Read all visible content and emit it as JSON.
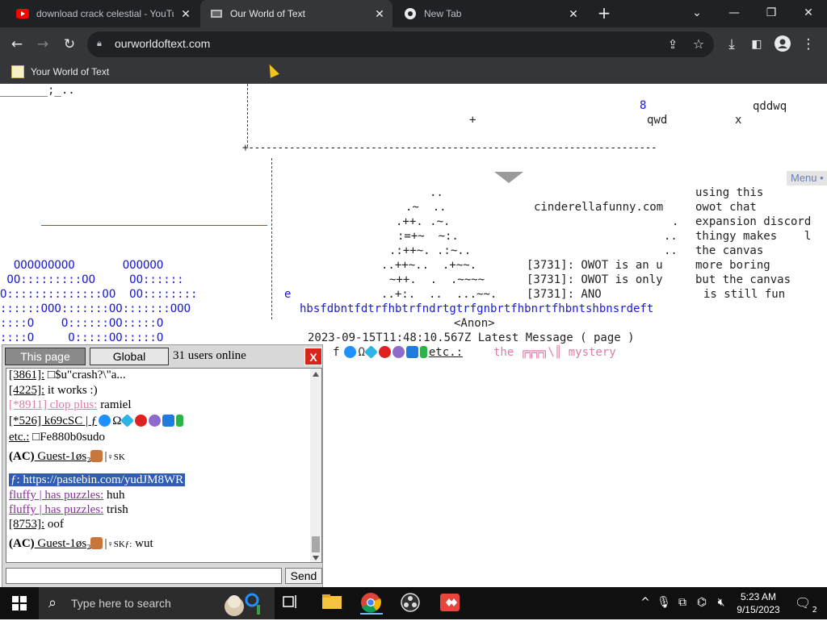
{
  "browser": {
    "tabs": [
      {
        "title": "download crack celestial - YouTu",
        "favicon": "youtube-icon",
        "active": false
      },
      {
        "title": "Our World of Text",
        "favicon": "owot-icon",
        "active": true
      },
      {
        "title": "New Tab",
        "favicon": "chrome-icon",
        "active": false
      }
    ],
    "url": "ourworldoftext.com",
    "bookmark": "Your World of Text"
  },
  "world": {
    "menu_label": "Menu •",
    "lines": {
      "top_left": "_______;_..",
      "num8": "8",
      "qddwq": "qddwq",
      "plus": "+",
      "qwd": "qwd",
      "x": "x",
      "dashes": "+----------------------------------------------------------------------",
      "tree1": "..",
      "tree2": ".~  ..",
      "tree3": ".++. .~.",
      "tree4": ":=+~  ~:.",
      "tree5": ".:++~. .:~..",
      "tree6": "..++~..  .+~~.",
      "tree7": "~++.  .  .~~~~",
      "tree8": "..+:.  ..  ...~~.",
      "cinderella": "cinderellafunny.com",
      "dot1": ".",
      "dot2": "..",
      "dot3": "..",
      "dot4": ".",
      "msg1": "[3731]: OWOT is an u",
      "msg2": "[3731]: OWOT is only",
      "msg3": "[3731]: ANO",
      "right1": "using this",
      "right2": "owot chat",
      "right3": "expansion discord",
      "right4": "thingy makes    l",
      "right5": "the canvas",
      "right6": "more boring",
      "right7": "but the canvas",
      "right8": "is still fun",
      "e": "e",
      "blue_row": "hbsfdbntfdtrfhbtrfndrtgtrfgnbrtfhbnrtfhbntshbnsrdeft",
      "timestamp": "2023-09-15T11:48:10.567Z Latest Message ( page )",
      "anon": "<Anon>",
      "f_prefix": "f",
      "etc": "etc.:",
      "mystery": "the ╔╦╦╗\\║ mystery",
      "art": [
        "  OOOOOOOOO       OOOOOO",
        " OO:::::::::OO     OO::::::",
        "O::::::::::::::OO  OO::::::::",
        "::::::OOO:::::::OO:::::::OOO",
        "::::O    O::::::OO:::::O",
        "::::O     O:::::OO:::::O"
      ]
    }
  },
  "chat": {
    "tab_page": "This page",
    "tab_global": "Global",
    "online": "31 users online",
    "close": "X",
    "send": "Send",
    "input_value": "",
    "messages": [
      {
        "nick": "[3861]:",
        "text": " □$u\"crash?\\\"a..."
      },
      {
        "nick": "[4225]:",
        "text": " it works :)"
      },
      {
        "nick": "[*8911] clop plus:",
        "text": " ramiel"
      },
      {
        "nick": "[*526] k69cSC | ƒ",
        "text": ""
      },
      {
        "nick": "etc.:",
        "text": " □Fe880b0sudo"
      },
      {
        "nick_prefix": "(AC)",
        "nick": " Guest-1øs₂",
        "text": "♀SK"
      },
      {
        "nick": "ƒ: https://pastebin.com/yudJM8WR",
        "text": ""
      },
      {
        "nick": "fluffy | has puzzles:",
        "text": " huh"
      },
      {
        "nick": "fluffy | has puzzles:",
        "text": " trish"
      },
      {
        "nick": "[8753]:",
        "text": " oof"
      },
      {
        "nick_prefix": "(AC)",
        "nick": " Guest-1øs₂",
        "text": "♀SKƒ:",
        "tail": " wut"
      }
    ]
  },
  "taskbar": {
    "search_placeholder": "Type here to search",
    "time": "5:23 AM",
    "date": "9/15/2023",
    "notifications": "2"
  },
  "colors": {
    "accent_blue": "#1a1adb",
    "pink": "#e07aa8",
    "purple": "#8b2d9c",
    "chat_close_red": "#d9241b",
    "art_blue": "#1a1adb"
  }
}
